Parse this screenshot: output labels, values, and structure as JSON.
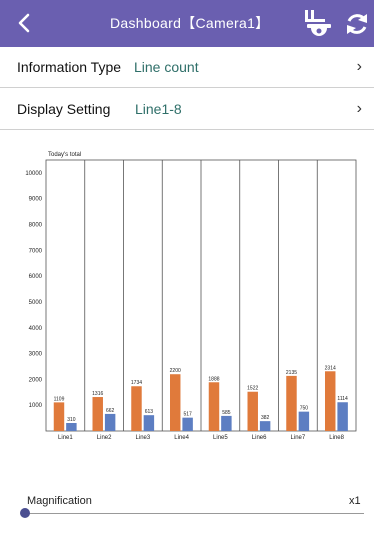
{
  "header": {
    "title": "Dashboard【Camera1】",
    "back_icon": "back-chevron-icon",
    "camera_icon": "camera-icon",
    "refresh_icon": "refresh-icon"
  },
  "settings": [
    {
      "label": "Information Type",
      "value": "Line count"
    },
    {
      "label": "Display Setting",
      "value": "Line1-8"
    }
  ],
  "colors": {
    "header": "#6a5fb0",
    "accent_value": "#2f6f69",
    "bar_total": "#e07a3b",
    "bar_other": "#5d7ec2",
    "slider": "#4b4f91"
  },
  "magnification": {
    "label": "Magnification",
    "value": "x1",
    "level": 0
  },
  "chart_data": {
    "type": "bar",
    "title": "Today's total",
    "categories": [
      "Line1",
      "Line2",
      "Line3",
      "Line4",
      "Line5",
      "Line6",
      "Line7",
      "Line8"
    ],
    "series": [
      {
        "values": [
          1109,
          1316,
          1734,
          2200,
          1888,
          1522,
          2135,
          2314
        ]
      },
      {
        "values": [
          310,
          662,
          613,
          517,
          585,
          382,
          750,
          1114
        ]
      }
    ],
    "y_ticks": [
      1000,
      2000,
      3000,
      4000,
      5000,
      6000,
      7000,
      8000,
      9000,
      10000
    ],
    "ylim": [
      0,
      10500
    ],
    "grid": false,
    "legend": "none"
  }
}
